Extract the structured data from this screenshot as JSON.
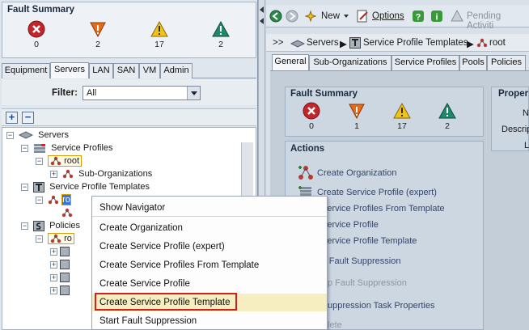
{
  "left": {
    "fault_summary": {
      "title": "Fault Summary",
      "counts": {
        "critical": "0",
        "major": "2",
        "minor": "17",
        "warning": "2"
      }
    },
    "tabs": [
      "Equipment",
      "Servers",
      "LAN",
      "SAN",
      "VM",
      "Admin"
    ],
    "active_tab": "Servers",
    "filter": {
      "label": "Filter:",
      "value": "All"
    },
    "tree": {
      "servers": "Servers",
      "service_profiles": "Service Profiles",
      "root": "root",
      "sub_orgs": "Sub-Organizations",
      "service_profile_templates": "Service Profile Templates",
      "root_sel": "ro",
      "policies": "Policies",
      "root_policies": "ro"
    }
  },
  "toolbar": {
    "new": "New",
    "options": "Options",
    "pending": "Pending Activiti"
  },
  "breadcrumb": {
    "prefix": ">>",
    "servers": "Servers",
    "templates": "Service Profile Templates",
    "root": "root"
  },
  "right_tabs": [
    "General",
    "Sub-Organizations",
    "Service Profiles",
    "Pools",
    "Policies"
  ],
  "right": {
    "fault_summary": {
      "title": "Fault Summary",
      "counts": {
        "critical": "0",
        "major": "1",
        "minor": "17",
        "warning": "2"
      }
    },
    "properties": {
      "title": "Proper",
      "name": "N",
      "description": "Descrip",
      "level": "L"
    },
    "actions_title": "Actions",
    "actions": [
      "Create Organization",
      "Create Service Profile (expert)",
      "Service Profiles From Template",
      "Service Profile",
      "Service Profile Template",
      "rt Fault Suppression",
      "p Fault Suppression",
      "uppression Task Properties",
      "lete"
    ]
  },
  "context_menu": [
    "Show Navigator",
    "Create Organization",
    "Create Service Profile (expert)",
    "Create Service Profiles From Template",
    "Create Service Profile",
    "Create Service Profile Template",
    "Start Fault Suppression"
  ],
  "colors": {
    "highlight_box": "#d02020",
    "selection": "#3875d7",
    "menu_hover": "#f6eec0"
  }
}
